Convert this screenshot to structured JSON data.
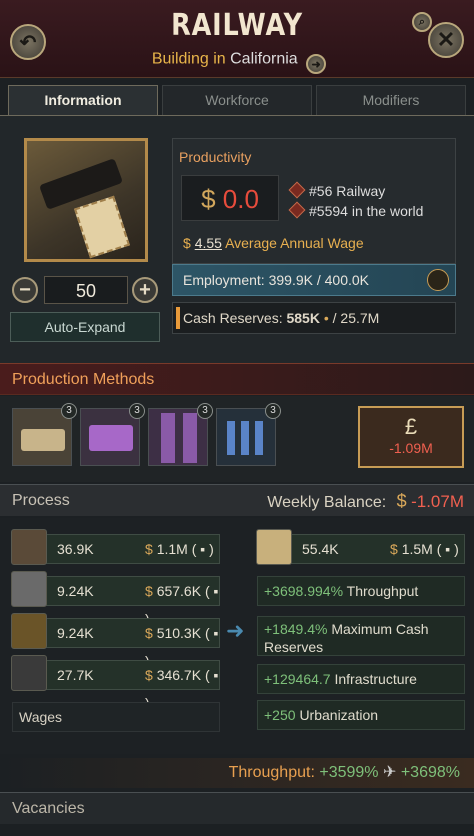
{
  "header": {
    "title": "RAILWAY",
    "subtitle_prefix": "Building in",
    "subtitle_location": "California"
  },
  "tabs": [
    {
      "label": "Information",
      "active": true
    },
    {
      "label": "Workforce",
      "active": false
    },
    {
      "label": "Modifiers",
      "active": false
    }
  ],
  "info": {
    "level": "50",
    "auto_expand": "Auto-Expand",
    "productivity_label": "Productivity",
    "productivity_value": "0.0",
    "currency": "$",
    "rank_type": "#56",
    "rank_type_suffix": "Railway",
    "rank_world": "#5594",
    "rank_world_suffix": "in the world",
    "avg_wage": "4.55",
    "avg_wage_label": "Average Annual Wage",
    "employment_label": "Employment:",
    "employment_value": "399.9K",
    "employment_max": "/ 400.0K",
    "cash_label": "Cash Reserves:",
    "cash_value": "585K",
    "cash_max": "/ 25.7M"
  },
  "production_methods": {
    "title": "Production Methods",
    "items": [
      {
        "icon": "locomotive-icon",
        "badge": "3"
      },
      {
        "icon": "passenger-car-icon",
        "badge": "3"
      },
      {
        "icon": "rail-tracks-icon",
        "badge": "3"
      },
      {
        "icon": "candlestick-chart-icon",
        "badge": "3"
      }
    ],
    "summary_icon": "pound-icon",
    "summary_value": "-1.09M"
  },
  "process": {
    "title": "Process",
    "weekly_balance_label": "Weekly Balance:",
    "weekly_balance_value": "-1.07M",
    "inputs": [
      {
        "icon": "engines-icon",
        "count": "36.9K",
        "price": "1.1M"
      },
      {
        "icon": "steel-icon",
        "count": "9.24K",
        "price": "657.6K"
      },
      {
        "icon": "transportation-icon",
        "count": "9.24K",
        "price": "510.3K"
      },
      {
        "icon": "oil-icon",
        "count": "27.7K",
        "price": "346.7K"
      }
    ],
    "wages_label": "Wages",
    "output": {
      "icon": "ticket-icon",
      "count": "55.4K",
      "price": "1.5M"
    },
    "effects": [
      {
        "value": "+3698.994%",
        "label": "Throughput"
      },
      {
        "value": "+1849.4%",
        "label": "Maximum Cash Reserves"
      },
      {
        "value": "+129464.7",
        "label": "Infrastructure"
      },
      {
        "value": "+250",
        "label": "Urbanization"
      }
    ]
  },
  "throughput": {
    "label": "Throughput:",
    "value_a": "+3599%",
    "value_b": "+3698%"
  },
  "vacancies": {
    "title": "Vacancies"
  },
  "colors": {
    "accent": "#e8a050",
    "negative": "#e74c3c",
    "positive": "#7ec07a"
  }
}
